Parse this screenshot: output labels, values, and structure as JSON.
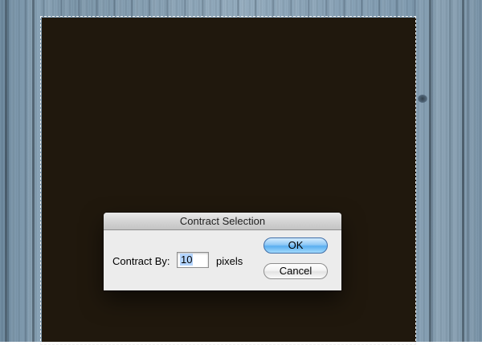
{
  "dialog": {
    "title": "Contract Selection",
    "field_label": "Contract By:",
    "field_value": "10",
    "unit": "pixels",
    "ok_label": "OK",
    "cancel_label": "Cancel"
  },
  "colors": {
    "canvas_fill": "#20180d",
    "wood": "#88a3b7",
    "dialog_bg": "#ececec",
    "ok_button": "#5aaef0"
  }
}
